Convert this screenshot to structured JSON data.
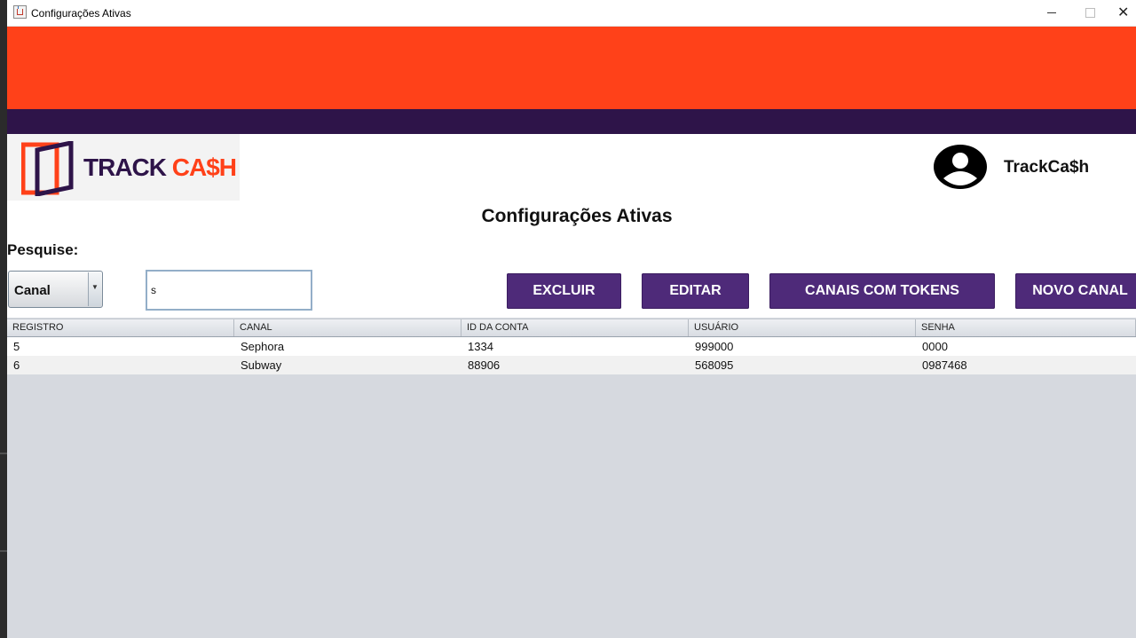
{
  "window": {
    "title": "Configurações Ativas"
  },
  "brand": {
    "logo_track": "TRACK",
    "logo_cash": "CA$H",
    "user_name": "TrackCa$h"
  },
  "colors": {
    "orange": "#ff4119",
    "dark_purple": "#2e1449",
    "button_purple": "#4e2a79",
    "table_bg": "#d6d9df"
  },
  "page": {
    "title": "Configurações Ativas",
    "search_label": "Pesquise:"
  },
  "search": {
    "field_selected": "Canal",
    "query": "s"
  },
  "buttons": {
    "excluir": "EXCLUIR",
    "editar": "EDITAR",
    "tokens": "CANAIS COM TOKENS",
    "novo": "NOVO CANAL"
  },
  "table": {
    "headers": [
      "REGISTRO",
      "CANAL",
      "ID DA CONTA",
      "USUÁRIO",
      "SENHA"
    ],
    "rows": [
      [
        "5",
        "Sephora",
        "1334",
        "999000",
        "0000"
      ],
      [
        "6",
        "Subway",
        "88906",
        "568095",
        "0987468"
      ]
    ]
  }
}
